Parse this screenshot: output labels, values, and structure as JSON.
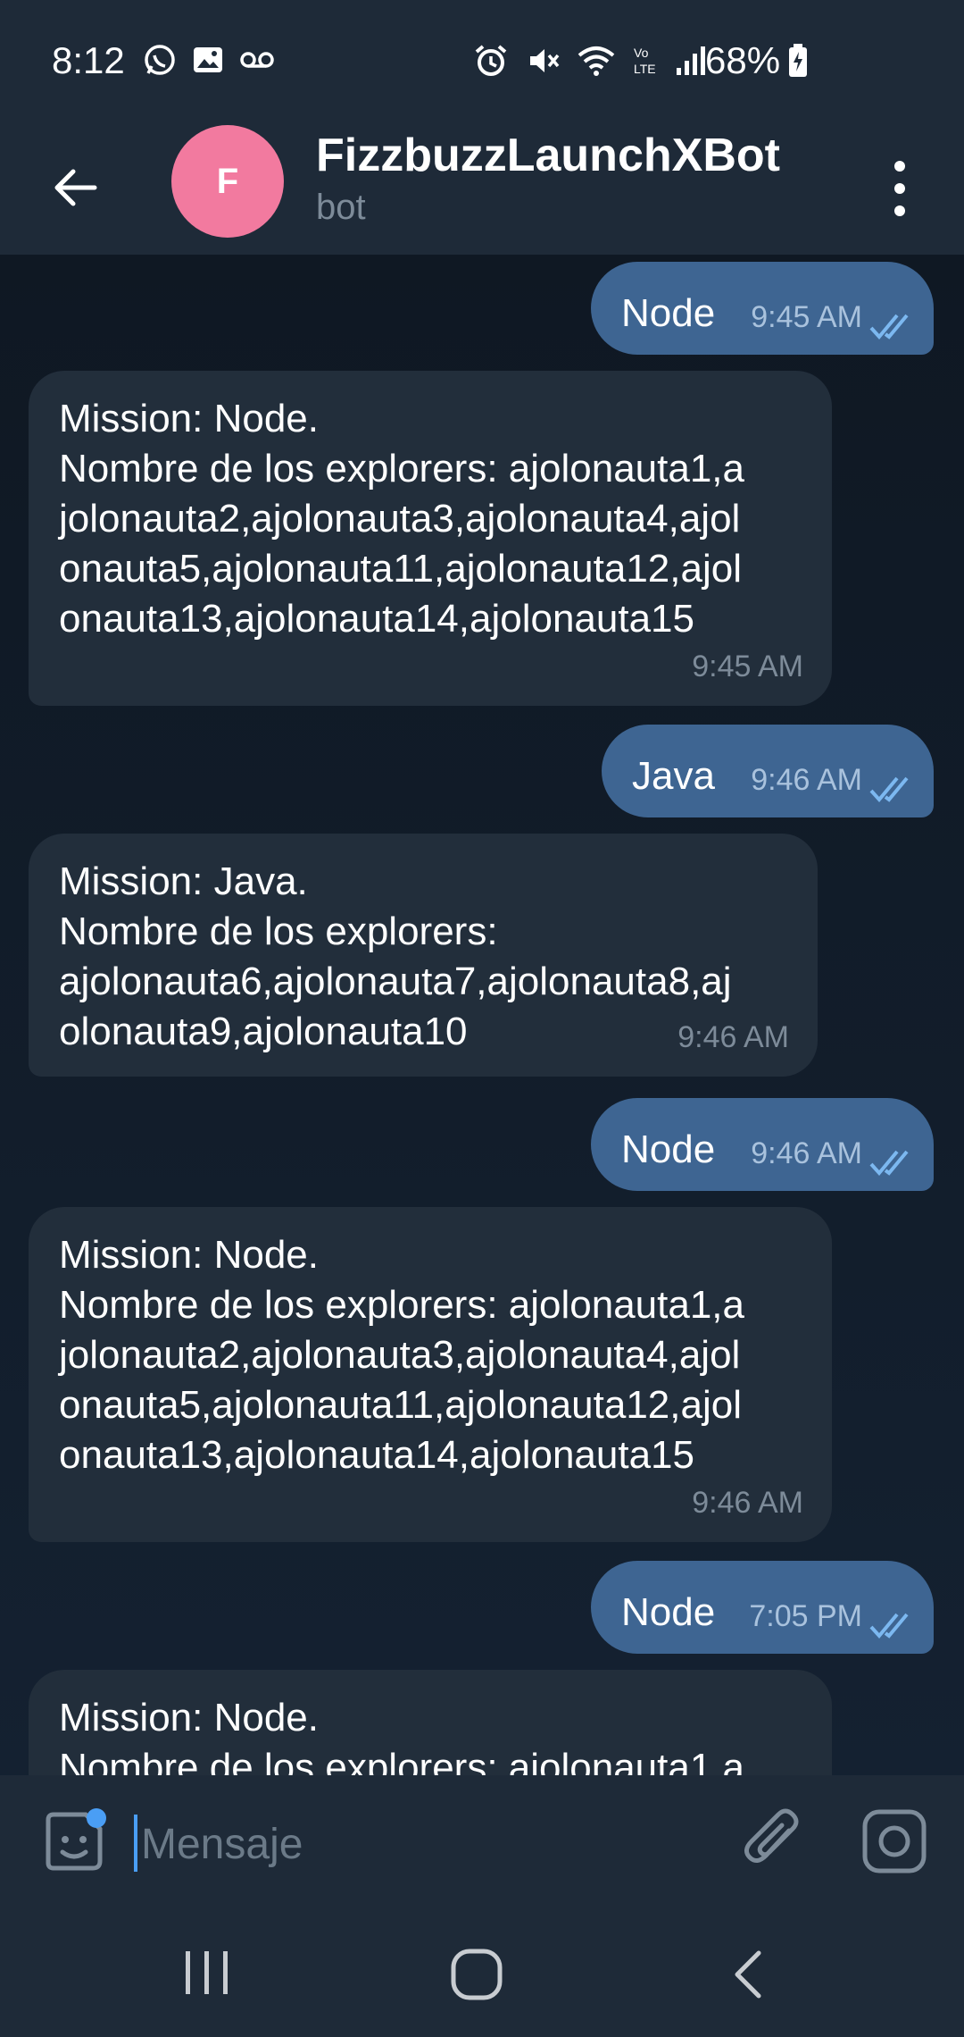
{
  "status_bar": {
    "time": "8:12",
    "battery": "68%"
  },
  "header": {
    "avatar_letter": "F",
    "title": "FizzbuzzLaunchXBot",
    "subtitle": "bot"
  },
  "messages": [
    {
      "direction": "out",
      "text": "Node",
      "time": "9:45 AM"
    },
    {
      "direction": "in",
      "text": "Mission: Node.\nNombre de los explorers: ajolonauta1,a\njolonauta2,ajolonauta3,ajolonauta4,ajol\nonauta5,ajolonauta11,ajolonauta12,ajol\nonauta13,ajolonauta14,ajolonauta15",
      "time": "9:45 AM"
    },
    {
      "direction": "out",
      "text": "Java",
      "time": "9:46 AM"
    },
    {
      "direction": "in",
      "text": "Mission: Java.\nNombre de los explorers:\najolonauta6,ajolonauta7,ajolonauta8,aj\nolonauta9,ajolonauta10",
      "time": "9:46 AM"
    },
    {
      "direction": "out",
      "text": "Node",
      "time": "9:46 AM"
    },
    {
      "direction": "in",
      "text": "Mission: Node.\nNombre de los explorers: ajolonauta1,a\njolonauta2,ajolonauta3,ajolonauta4,ajol\nonauta5,ajolonauta11,ajolonauta12,ajol\nonauta13,ajolonauta14,ajolonauta15",
      "time": "9:46 AM"
    },
    {
      "direction": "out",
      "text": "Node",
      "time": "7:05 PM"
    },
    {
      "direction": "in",
      "text": "Mission: Node.\nNombre de los explorers: ajolonauta1,a",
      "time": ""
    }
  ],
  "composer": {
    "placeholder": "Mensaje"
  },
  "icons": {
    "back": "arrow-left-icon",
    "menu": "more-vertical-icon",
    "sticker": "sticker-icon",
    "attach": "paperclip-icon",
    "camera": "instagram-camera-icon"
  },
  "colors": {
    "outgoing_bubble": "#3e6592",
    "incoming_bubble": "#222e3b",
    "avatar": "#f27a9f"
  }
}
